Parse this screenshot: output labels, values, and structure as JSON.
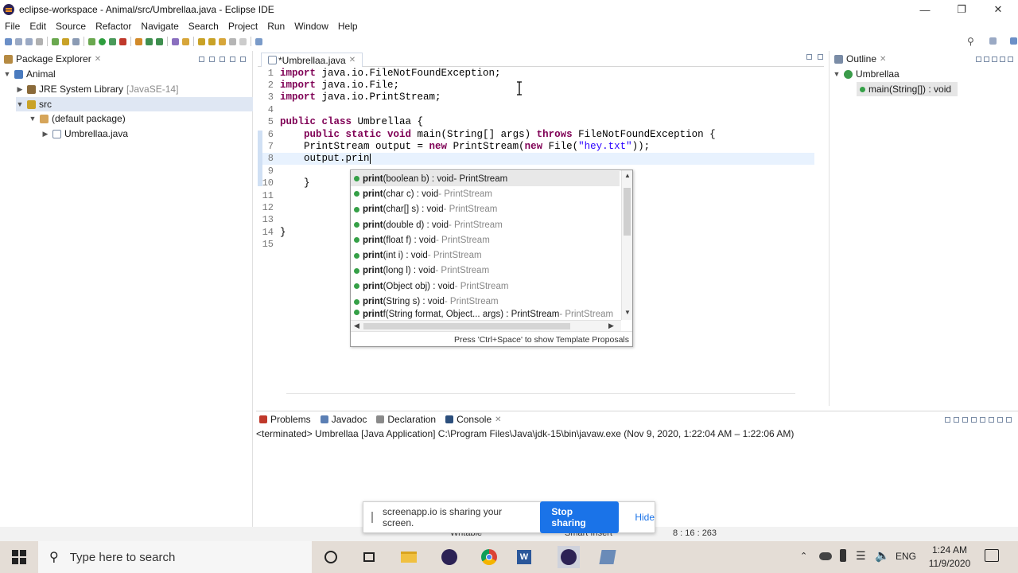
{
  "window": {
    "title": "eclipse-workspace - Animal/src/Umbrellaa.java - Eclipse IDE"
  },
  "menu": [
    "File",
    "Edit",
    "Source",
    "Refactor",
    "Navigate",
    "Search",
    "Project",
    "Run",
    "Window",
    "Help"
  ],
  "package_explorer": {
    "title": "Package Explorer",
    "items": [
      {
        "label": "Animal",
        "extra": ""
      },
      {
        "label": "JRE System Library",
        "extra": "[JavaSE-14]"
      },
      {
        "label": "src",
        "extra": ""
      },
      {
        "label": "(default package)",
        "extra": ""
      },
      {
        "label": "Umbrellaa.java",
        "extra": ""
      }
    ]
  },
  "editor": {
    "tab_label": "*Umbrellaa.java",
    "lines": [
      "1",
      "2",
      "3",
      "4",
      "5",
      "6",
      "7",
      "8",
      "9",
      "10",
      "11",
      "12",
      "13",
      "14",
      "15"
    ],
    "code": {
      "l1_kw": "import",
      "l1": " java.io.FileNotFoundException;",
      "l2_kw": "import",
      "l2": " java.io.File;",
      "l3_kw": "import",
      "l3": " java.io.PrintStream;",
      "l5_kw": "public class",
      "l5": " Umbrellaa {",
      "l6_kw": "public static void",
      "l6a": " main(String[] args) ",
      "l6_kw2": "throws",
      "l6b": " FileNotFoundException {",
      "l7a": "PrintStream output = ",
      "l7_kw": "new",
      "l7b": " PrintStream(",
      "l7_kw2": "new",
      "l7c": " File(",
      "l7_str": "\"hey.txt\"",
      "l7d": "));",
      "l8": "output.prin",
      "l10": "}",
      "l14": "}"
    }
  },
  "content_assist": {
    "proposals": [
      {
        "bold": "print",
        "rest": "(boolean b) : void",
        "type": " - PrintStream"
      },
      {
        "bold": "print",
        "rest": "(char c) : void",
        "type": " - PrintStream"
      },
      {
        "bold": "print",
        "rest": "(char[] s) : void",
        "type": " - PrintStream"
      },
      {
        "bold": "print",
        "rest": "(double d) : void",
        "type": " - PrintStream"
      },
      {
        "bold": "print",
        "rest": "(float f) : void",
        "type": " - PrintStream"
      },
      {
        "bold": "print",
        "rest": "(int i) : void",
        "type": " - PrintStream"
      },
      {
        "bold": "print",
        "rest": "(long l) : void",
        "type": " - PrintStream"
      },
      {
        "bold": "print",
        "rest": "(Object obj) : void",
        "type": " - PrintStream"
      },
      {
        "bold": "print",
        "rest": "(String s) : void",
        "type": " - PrintStream"
      },
      {
        "bold": "print",
        "rest": "f(String format, Object... args) : PrintStream",
        "type": " - PrintStream"
      }
    ],
    "hint": "Press 'Ctrl+Space' to show Template Proposals"
  },
  "outline": {
    "title": "Outline",
    "class_name": "Umbrellaa",
    "method": "main(String[]) : void"
  },
  "bottom_panel": {
    "tabs": [
      "Problems",
      "Javadoc",
      "Declaration",
      "Console"
    ],
    "console_line": "<terminated> Umbrellaa [Java Application] C:\\Program Files\\Java\\jdk-15\\bin\\javaw.exe  (Nov 9, 2020, 1:22:04 AM – 1:22:06 AM)"
  },
  "sharing_banner": {
    "message": "screenapp.io is sharing your screen.",
    "stop_label": "Stop sharing",
    "hide_label": "Hide"
  },
  "status_bar": {
    "writable": "Writable",
    "insert": "Smart Insert",
    "position": "8 : 16 : 263"
  },
  "taskbar": {
    "search_placeholder": "Type here to search",
    "language": "ENG",
    "time": "1:24 AM",
    "date": "11/9/2020"
  },
  "colors": {
    "keyword": "#7f0055",
    "string": "#2a00ff",
    "accent": "#1a73e8",
    "taskbar": "#e4ddd6"
  }
}
